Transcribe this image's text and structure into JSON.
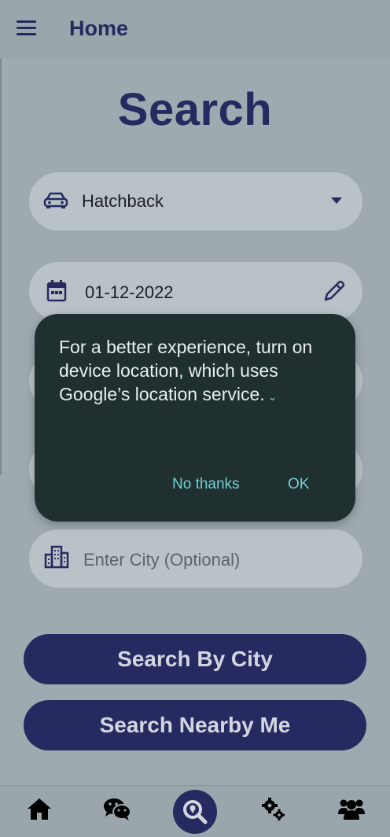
{
  "appbar": {
    "title": "Home"
  },
  "page": {
    "title": "Search"
  },
  "form": {
    "vehicle_type": "Hatchback",
    "date": "01-12-2022",
    "city_placeholder": "Enter City (Optional)"
  },
  "dialog": {
    "message": "For a better experience, turn on device location, which uses Google’s location service.",
    "expand_glyph": "⌄",
    "no_thanks_label": "No thanks",
    "ok_label": "OK"
  },
  "buttons": {
    "search_by_city": "Search By City",
    "search_nearby": "Search Nearby Me"
  },
  "bottom_nav": {
    "items": [
      "home-icon",
      "chat-icon",
      "search-location-icon",
      "settings-icon",
      "users-icon"
    ]
  },
  "colors": {
    "primary": "#262a60",
    "dialog_bg": "#202f30",
    "dialog_accent": "#6fd3d6",
    "field_bg": "#b8c2c7"
  }
}
